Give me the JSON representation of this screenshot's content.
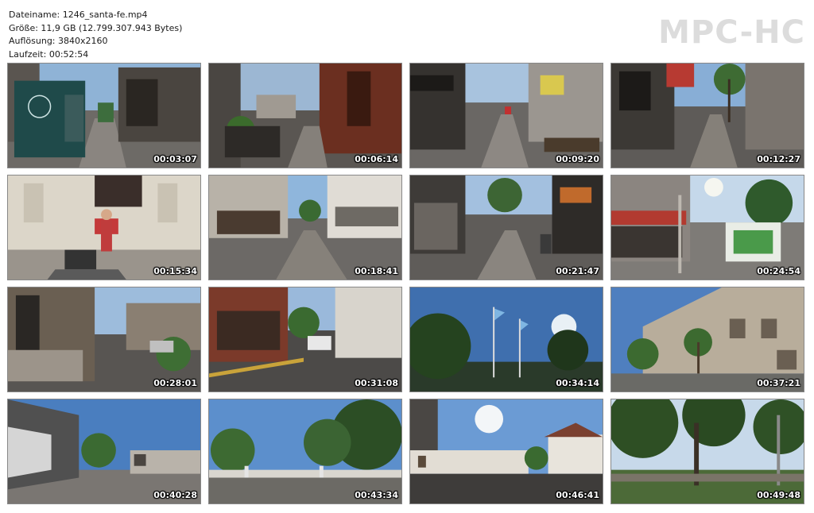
{
  "info": {
    "filename": "Dateiname: 1246_santa-fe.mp4",
    "size": "Größe: 11,9 GB (12.799.307.943 Bytes)",
    "resolution": "Auflösung: 3840x2160",
    "duration": "Laufzeit: 00:52:54"
  },
  "brand": {
    "logo": "MPC-HC",
    "logo_color": "#dcdcdc"
  },
  "thumbnails": [
    {
      "timestamp": "00:03:07",
      "scene": "pedestrian-street-with-kiosk"
    },
    {
      "timestamp": "00:06:14",
      "scene": "street-with-planters"
    },
    {
      "timestamp": "00:09:20",
      "scene": "shopping-street"
    },
    {
      "timestamp": "00:12:27",
      "scene": "palm-lined-street"
    },
    {
      "timestamp": "00:15:34",
      "scene": "street-musician"
    },
    {
      "timestamp": "00:18:41",
      "scene": "pedestrian-street"
    },
    {
      "timestamp": "00:21:47",
      "scene": "shopping-street"
    },
    {
      "timestamp": "00:24:54",
      "scene": "street-with-sign"
    },
    {
      "timestamp": "00:28:01",
      "scene": "residential-street"
    },
    {
      "timestamp": "00:31:08",
      "scene": "street-corner"
    },
    {
      "timestamp": "00:34:14",
      "scene": "flags-and-trees"
    },
    {
      "timestamp": "00:37:21",
      "scene": "government-building"
    },
    {
      "timestamp": "00:40:28",
      "scene": "modern-building"
    },
    {
      "timestamp": "00:43:34",
      "scene": "park-trees"
    },
    {
      "timestamp": "00:46:41",
      "scene": "street-sun"
    },
    {
      "timestamp": "00:49:48",
      "scene": "park"
    }
  ]
}
